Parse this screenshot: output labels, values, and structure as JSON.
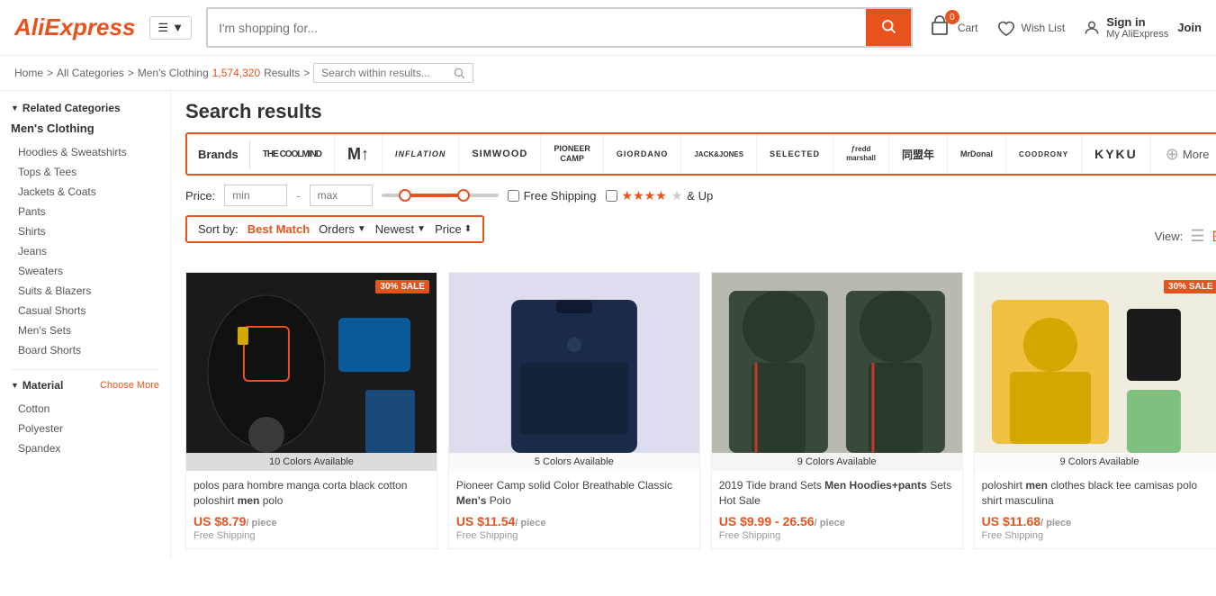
{
  "header": {
    "logo": "AliExpress",
    "search_placeholder": "I'm shopping for...",
    "cart_label": "Cart",
    "cart_count": "0",
    "wishlist_label": "Wish List",
    "signin_label": "Sign in",
    "join_label": "Join",
    "myaliexpress_label": "My AliExpress"
  },
  "breadcrumb": {
    "home": "Home",
    "all_categories": "All Categories",
    "category": "Men's Clothing",
    "results_count": "1,574,320",
    "results_label": "Results",
    "search_placeholder": "Search within results..."
  },
  "search_results": {
    "title": "Search results"
  },
  "brands": {
    "label": "Brands",
    "items": [
      {
        "name": "THE COOLMIND",
        "style": "coolmind"
      },
      {
        "name": "M↑",
        "style": "m1"
      },
      {
        "name": "INFLATION",
        "style": "inflation"
      },
      {
        "name": "SIMWOOD",
        "style": "simwood"
      },
      {
        "name": "Pioneer Camp",
        "style": "pioneer"
      },
      {
        "name": "GIORDANO",
        "style": "giordano"
      },
      {
        "name": "JACK&JONES",
        "style": "jack"
      },
      {
        "name": "SELECTED",
        "style": "selected"
      },
      {
        "name": "Fred Marshall",
        "style": "fred"
      },
      {
        "name": "同盟年",
        "style": "chinese"
      },
      {
        "name": "MrDonal",
        "style": "mrdonal"
      },
      {
        "name": "COODRONY",
        "style": "coodrony"
      },
      {
        "name": "KYKU",
        "style": "kyku"
      }
    ],
    "more_label": "More"
  },
  "filters": {
    "price_label": "Price:",
    "min_placeholder": "min",
    "max_placeholder": "max",
    "free_shipping_label": "Free Shipping",
    "stars_up_label": "& Up"
  },
  "sort": {
    "label": "Sort by:",
    "options": [
      {
        "label": "Best Match",
        "active": true
      },
      {
        "label": "Orders",
        "has_arrow": true
      },
      {
        "label": "Newest",
        "has_arrow": true
      },
      {
        "label": "Price",
        "has_arrow": true
      }
    ]
  },
  "view": {
    "label": "View:",
    "list_label": "list",
    "grid_label": "grid"
  },
  "sidebar": {
    "related_label": "Related Categories",
    "category_title": "Men's Clothing",
    "items": [
      {
        "label": "Hoodies & Sweatshirts"
      },
      {
        "label": "Tops & Tees"
      },
      {
        "label": "Jackets & Coats"
      },
      {
        "label": "Pants"
      },
      {
        "label": "Shirts"
      },
      {
        "label": "Jeans"
      },
      {
        "label": "Sweaters"
      },
      {
        "label": "Suits & Blazers"
      },
      {
        "label": "Casual Shorts"
      },
      {
        "label": "Men's Sets"
      },
      {
        "label": "Board Shorts"
      }
    ],
    "material_label": "Material",
    "choose_more": "Choose More",
    "materials": [
      {
        "label": "Cotton"
      },
      {
        "label": "Polyester"
      },
      {
        "label": "Spandex"
      }
    ]
  },
  "products": [
    {
      "id": 1,
      "colors": "10 Colors Available",
      "sale_badge": "30% SALE",
      "title": "polos para hombre manga corta black cotton poloshirt",
      "title_strong": "men",
      "title_end": "polo",
      "price": "US $8.79",
      "unit": "/ piece",
      "shipping": "Free Shipping",
      "bg": "#1a1a1a"
    },
    {
      "id": 2,
      "colors": "5 Colors Available",
      "sale_badge": null,
      "title": "Pioneer Camp solid Color Breathable Classic",
      "title_strong": "Men's",
      "title_end": "Polo",
      "price": "US $11.54",
      "unit": "/ piece",
      "shipping": "Free Shipping",
      "bg": "#1c2a4a"
    },
    {
      "id": 3,
      "colors": "9 Colors Available",
      "sale_badge": null,
      "title": "2019 Tide brand Sets",
      "title_strong": "Men Hoodies+pants",
      "title_end": "Sets Hot Sale",
      "price": "US $9.99 - 26.56",
      "unit": "/ piece",
      "shipping": "Free Shipping",
      "bg": "#3a4a3a"
    },
    {
      "id": 4,
      "colors": "9 Colors Available",
      "sale_badge": "30% SALE",
      "title": "poloshirt",
      "title_strong": "men",
      "title_end": "clothes black tee camisas polo shirt masculina",
      "price": "US $11.68",
      "unit": "/ piece",
      "shipping": "Free Shipping",
      "bg": "#f0c040"
    }
  ]
}
